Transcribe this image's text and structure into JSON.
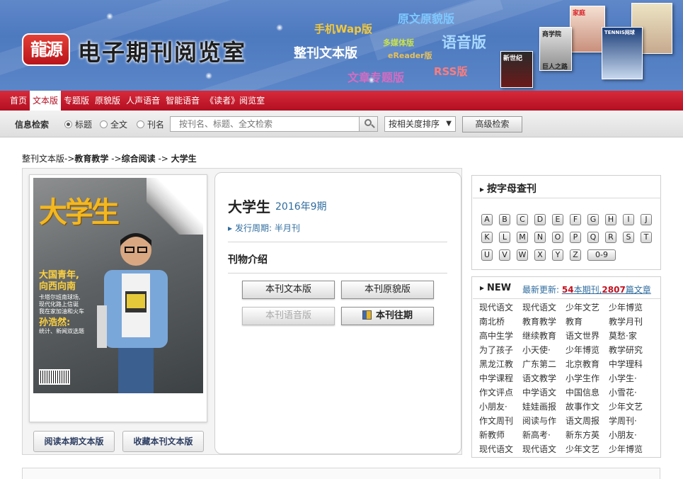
{
  "banner": {
    "logo_text": "龍源",
    "site_title": "电子期刊阅览室",
    "tags": {
      "wap": "手机Wap版",
      "yuanwen": "原文原貌版",
      "media": "多媒体版",
      "voice": "语音版",
      "fulltext": "整刊文本版",
      "ereader": "eReader版",
      "article": "文章专题版",
      "rss": "RSS版"
    },
    "magazine_labels": [
      "家庭",
      "新世纪",
      "商学院",
      "巨人之路",
      "TENNIS网球"
    ]
  },
  "nav": {
    "items": [
      "首页",
      "文本版",
      "专题版",
      "原貌版",
      "人声语音",
      "智能语音",
      "《读者》阅览室"
    ],
    "active_index": 1
  },
  "search": {
    "label": "信息检索",
    "options": [
      "标题",
      "全文",
      "刊名"
    ],
    "selected_index": 0,
    "placeholder": "按刊名、标题、全文检索",
    "sort_value": "按相关度排序",
    "advanced_label": "高级检索"
  },
  "breadcrumb": {
    "part1": "整刊文本版->",
    "part2": "教育教学",
    "part3": " ->",
    "part4": "综合阅读",
    "part5": " -> ",
    "part6": "大学生"
  },
  "cover": {
    "title": "大学生",
    "headline1_line1": "大国青年,",
    "headline1_line2": "向西向南",
    "headline2_line1": "卡塔尔班南球场,",
    "headline2_line2": "现代化路上信诞",
    "headline2_line3": "我在家加油和火车",
    "headline3": "孙浩然:",
    "headline4": "统计、新闻双选题"
  },
  "magazine": {
    "name": "大学生",
    "issue": "2016年9期",
    "period_label": "发行周期: 半月刊",
    "intro_title": "刊物介绍",
    "buttons": {
      "text_version": "本刊文本版",
      "original_version": "本刊原貌版",
      "audio_version": "本刊语音版",
      "past_issues": "本刊往期"
    },
    "read_button": "阅读本期文本版",
    "collect_button": "收藏本刊文本版"
  },
  "letters": {
    "title": "按字母查刊",
    "items": [
      "A",
      "B",
      "C",
      "D",
      "E",
      "F",
      "G",
      "H",
      "I",
      "J",
      "K",
      "L",
      "M",
      "N",
      "O",
      "P",
      "Q",
      "R",
      "S",
      "T",
      "U",
      "V",
      "W",
      "X",
      "Y",
      "Z",
      "0-9"
    ]
  },
  "new_panel": {
    "title": "NEW",
    "latest_prefix": "最新更新: ",
    "issue_count": "54",
    "issue_suffix": "本期刊,",
    "article_count": "2807",
    "article_suffix": "篇文章",
    "grid": [
      [
        "现代语文",
        "现代语文",
        "少年文艺",
        "少年博览"
      ],
      [
        "南北桥",
        "教育教学",
        "教育",
        "教学月刊"
      ],
      [
        "高中生学",
        "继续教育",
        "语文世界",
        "莫愁·家"
      ],
      [
        "为了孩子",
        "小天使·",
        "少年博览",
        "教学研究"
      ],
      [
        "黑龙江教",
        "广东第二",
        "北京教育",
        "中学理科"
      ],
      [
        "中学课程",
        "语文教学",
        "小学生作",
        "小学生·"
      ],
      [
        "作文评点",
        "中学语文",
        "中国信息",
        "小雪花·"
      ],
      [
        "小朋友·",
        "娃娃画报",
        "故事作文",
        "少年文艺"
      ],
      [
        "作文周刊",
        "阅读与作",
        "语文周报",
        "学周刊·"
      ],
      [
        "新教师",
        "新高考·",
        "新东方英",
        "小朋友·"
      ],
      [
        "现代语文",
        "现代语文",
        "少年文艺",
        "少年博览"
      ]
    ]
  }
}
